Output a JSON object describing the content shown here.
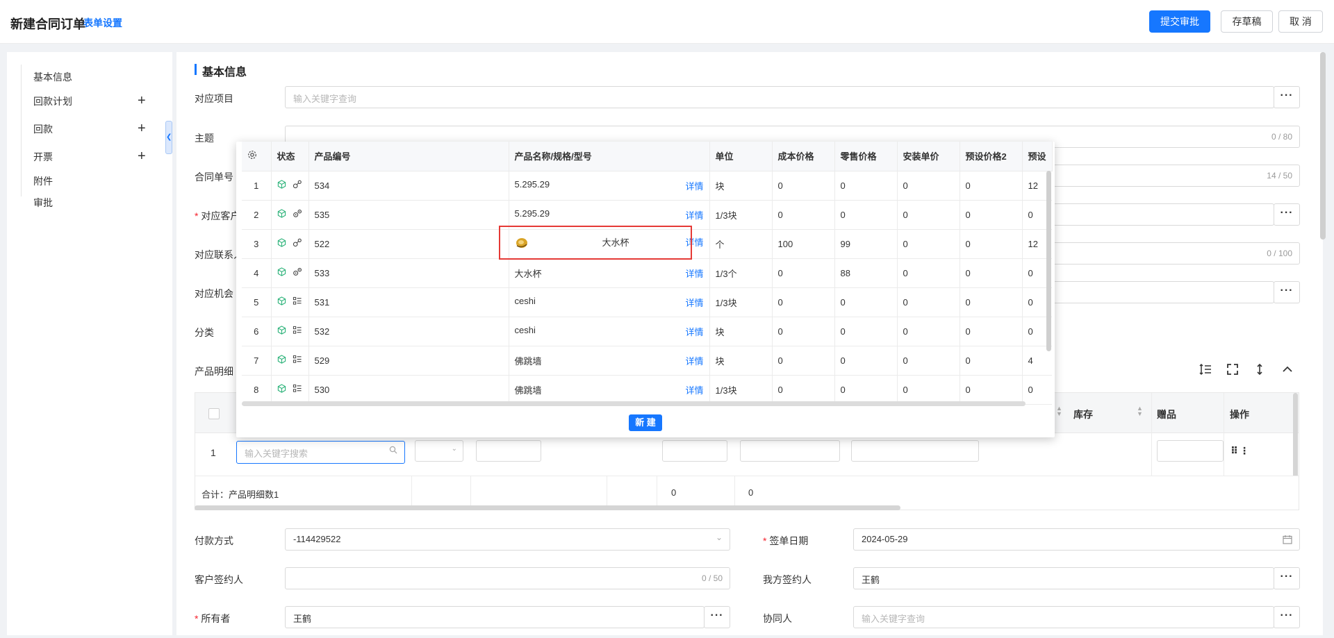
{
  "header": {
    "title": "新建合同订单",
    "form_settings": "表单设置",
    "submit": "提交审批",
    "draft": "存草稿",
    "cancel": "取 消"
  },
  "sidebar": {
    "items": [
      "基本信息",
      "回款计划",
      "回款",
      "开票",
      "附件",
      "审批"
    ],
    "plus": "+"
  },
  "section": {
    "title": "基本信息"
  },
  "form": {
    "project_label": "对应项目",
    "project_placeholder": "输入关键字查询",
    "subject_label": "主题",
    "subject_count": "0 / 80",
    "contract_no_label": "合同单号",
    "contract_no_count": "14 / 50",
    "customer_label": "对应客户",
    "contact_label": "对应联系人",
    "contact_count": "0 / 100",
    "opportunity_label": "对应机会",
    "category_label": "分类",
    "product_detail_label": "产品明细",
    "payment_label": "付款方式",
    "payment_value": "-114429522",
    "sign_date_label": "签单日期",
    "sign_date_value": "2024-05-29",
    "customer_signer_label": "客户签约人",
    "customer_signer_count": "0 / 50",
    "our_signer_label": "我方签约人",
    "our_signer_value": "王鹤",
    "owner_label": "所有者",
    "owner_value": "王鹤",
    "collaborator_label": "协同人",
    "collaborator_placeholder": "输入关键字查询",
    "ellipsis": "···"
  },
  "product_table": {
    "headers": {
      "stock": "库存",
      "gift": "赠品",
      "action": "操作"
    },
    "row_index": "1",
    "search_placeholder": "输入关键字搜索",
    "total_label": "合计：产品明细数1",
    "total_a": "0",
    "total_b": "0"
  },
  "popup": {
    "headers": [
      "状态",
      "产品编号",
      "产品名称/规格/型号",
      "单位",
      "成本价格",
      "零售价格",
      "安装单价",
      "预设价格2",
      "预设"
    ],
    "detail_label": "详情",
    "rows": [
      {
        "idx": "1",
        "code": "534",
        "name": "5.295.29",
        "unit": "块",
        "cost": "0",
        "retail": "0",
        "install": "0",
        "preset2": "0",
        "preset": "12"
      },
      {
        "idx": "2",
        "code": "535",
        "name": "5.295.29",
        "unit": "1/3块",
        "cost": "0",
        "retail": "0",
        "install": "0",
        "preset2": "0",
        "preset": "0"
      },
      {
        "idx": "3",
        "code": "522",
        "name": "大水杯",
        "unit": "个",
        "cost": "100",
        "retail": "99",
        "install": "0",
        "preset2": "0",
        "preset": "12"
      },
      {
        "idx": "4",
        "code": "533",
        "name": "大水杯",
        "unit": "1/3个",
        "cost": "0",
        "retail": "88",
        "install": "0",
        "preset2": "0",
        "preset": "0"
      },
      {
        "idx": "5",
        "code": "531",
        "name": "ceshi",
        "unit": "1/3块",
        "cost": "0",
        "retail": "0",
        "install": "0",
        "preset2": "0",
        "preset": "0"
      },
      {
        "idx": "6",
        "code": "532",
        "name": "ceshi",
        "unit": "块",
        "cost": "0",
        "retail": "0",
        "install": "0",
        "preset2": "0",
        "preset": "0"
      },
      {
        "idx": "7",
        "code": "529",
        "name": "佛跳墙",
        "unit": "块",
        "cost": "0",
        "retail": "0",
        "install": "0",
        "preset2": "0",
        "preset": "4"
      },
      {
        "idx": "8",
        "code": "530",
        "name": "佛跳墙",
        "unit": "1/3块",
        "cost": "0",
        "retail": "0",
        "install": "0",
        "preset2": "0",
        "preset": "0"
      }
    ],
    "new_button": "新 建"
  },
  "colors": {
    "primary": "#1677ff",
    "status_green": "#2db37a",
    "highlight": "#e53935"
  }
}
